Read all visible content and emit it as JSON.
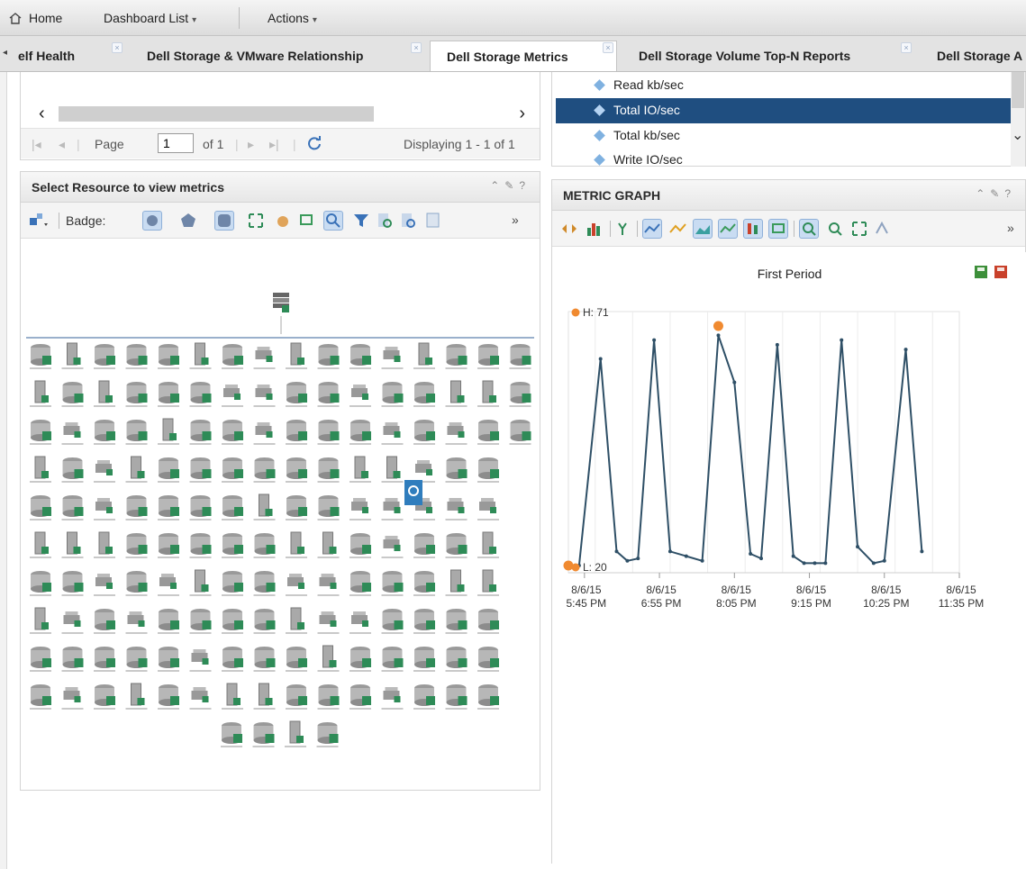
{
  "topnav": {
    "home_label": "Home",
    "dashboard_label": "Dashboard List",
    "actions_label": "Actions"
  },
  "tabs": [
    {
      "label": "elf Health",
      "active": false
    },
    {
      "label": "Dell Storage & VMware Relationship",
      "active": false
    },
    {
      "label": "Dell Storage Metrics",
      "active": true
    },
    {
      "label": "Dell Storage Volume Top-N Reports",
      "active": false
    },
    {
      "label": "Dell Storage A",
      "active": false
    }
  ],
  "pager": {
    "page_label": "Page",
    "page_value": "1",
    "of_label": "of 1",
    "displaying": "Displaying 1 - 1 of 1"
  },
  "resource_panel": {
    "title": "Select Resource to view metrics",
    "badge_label": "Badge:"
  },
  "metric_list": {
    "items": [
      {
        "label": "Read kb/sec",
        "selected": false
      },
      {
        "label": "Total IO/sec",
        "selected": true
      },
      {
        "label": "Total kb/sec",
        "selected": false
      },
      {
        "label": "Write IO/sec",
        "selected": false
      }
    ]
  },
  "graph_panel": {
    "title": "METRIC GRAPH"
  },
  "colors": {
    "selection": "#1f4e80",
    "line": "#2e4f66",
    "marker": "#f08a30",
    "save_green": "#3d8f3a",
    "save_red": "#c9412b"
  },
  "chart_data": {
    "type": "line",
    "title": "First Period",
    "high_label": "H: 71",
    "low_label": "L: 20",
    "ylim": [
      20,
      71
    ],
    "x_tick_labels": [
      {
        "date": "8/6/15",
        "time": "5:45 PM"
      },
      {
        "date": "8/6/15",
        "time": "6:55 PM"
      },
      {
        "date": "8/6/15",
        "time": "8:05 PM"
      },
      {
        "date": "8/6/15",
        "time": "9:15 PM"
      },
      {
        "date": "8/6/15",
        "time": "10:25 PM"
      },
      {
        "date": "8/6/15",
        "time": "11:35 PM"
      }
    ],
    "x_tick_minutes": [
      0,
      70,
      140,
      210,
      280,
      350
    ],
    "xlim_minutes": [
      -15,
      350
    ],
    "grid": true,
    "series": [
      {
        "points": [
          [
            -15,
            20
          ],
          [
            -5,
            20
          ],
          [
            15,
            64
          ],
          [
            30,
            23
          ],
          [
            40,
            21
          ],
          [
            50,
            21.5
          ],
          [
            65,
            68
          ],
          [
            80,
            23
          ],
          [
            95,
            22
          ],
          [
            110,
            21
          ],
          [
            125,
            69
          ],
          [
            140,
            59
          ],
          [
            155,
            22.5
          ],
          [
            165,
            21.5
          ],
          [
            180,
            67
          ],
          [
            195,
            22
          ],
          [
            205,
            20.5
          ],
          [
            215,
            20.5
          ],
          [
            225,
            20.5
          ],
          [
            240,
            68
          ],
          [
            255,
            24
          ],
          [
            270,
            20.5
          ],
          [
            280,
            21
          ],
          [
            300,
            66
          ],
          [
            315,
            23
          ]
        ]
      }
    ],
    "high_point": [
      125,
      71
    ],
    "low_point": [
      -15,
      20
    ]
  }
}
